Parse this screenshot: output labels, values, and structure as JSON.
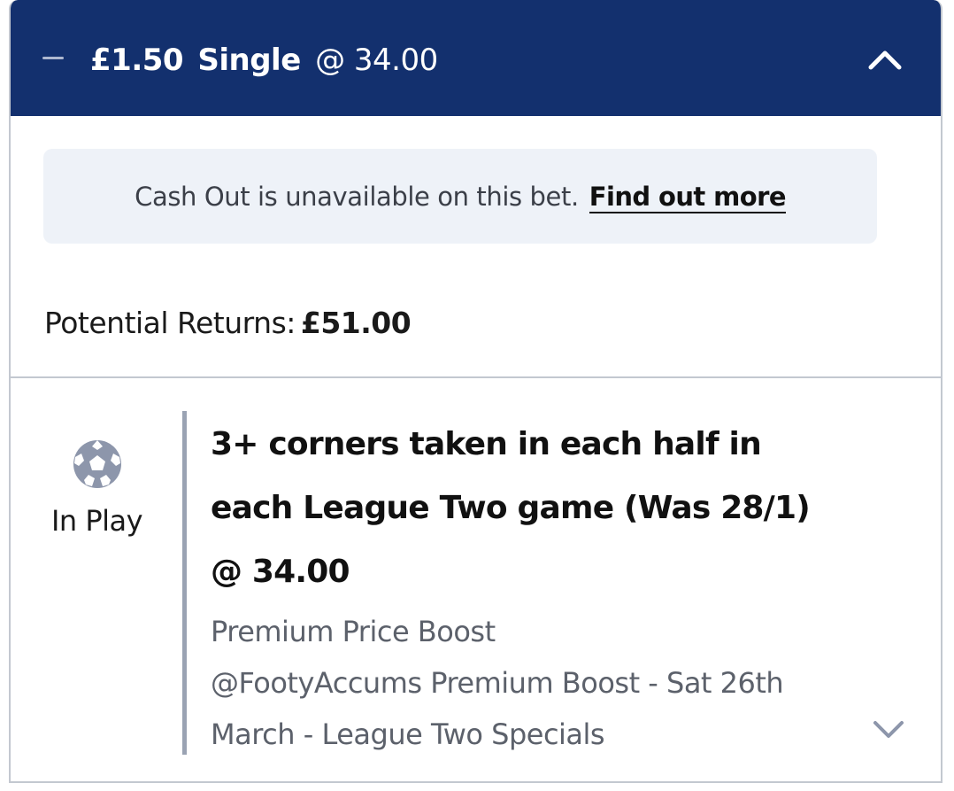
{
  "header": {
    "stake": "£1.50",
    "bet_type": "Single",
    "odds": "@ 34.00"
  },
  "cashout": {
    "message": "Cash Out is unavailable on this bet.",
    "link_label": "Find out more"
  },
  "returns": {
    "label": "Potential Returns:",
    "amount": "£51.00"
  },
  "selection": {
    "status_label": "In Play",
    "sport_icon": "football-icon",
    "title_lines": [
      "3+ corners taken in each half in",
      "each League Two game (Was 28/1)",
      "@ 34.00"
    ],
    "market_lines": [
      "Premium Price Boost",
      "@FootyAccums Premium Boost - Sat 26th",
      "March - League Two Specials"
    ]
  },
  "colors": {
    "header_bg": "#13306e",
    "notice_bg": "#eef2f8",
    "border": "#c3c8d0",
    "accent_bar": "#9aa3b3"
  }
}
